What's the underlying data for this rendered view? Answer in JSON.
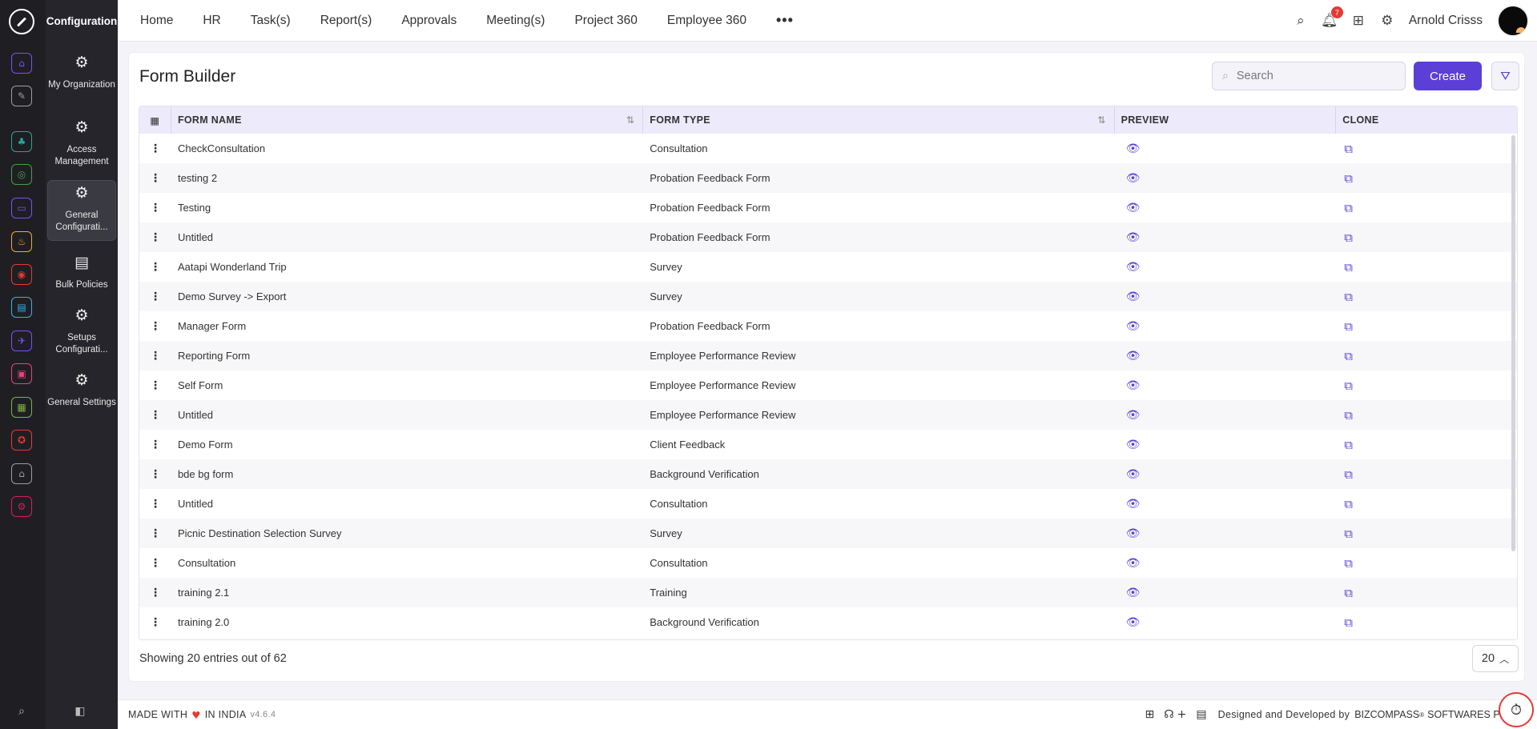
{
  "app": {
    "module_title": "Configuration"
  },
  "rail": {
    "items": [
      {
        "icon": "home-icon",
        "color": "#7c4dff",
        "glyph": "⌂"
      },
      {
        "icon": "pin-icon",
        "color": "#9e9e9e",
        "glyph": "✎"
      },
      {
        "icon": "team-icon",
        "color": "#26a69a",
        "glyph": "♣"
      },
      {
        "icon": "globe-icon",
        "color": "#43a047",
        "glyph": "◎"
      },
      {
        "icon": "briefcase-icon",
        "color": "#7c4dff",
        "glyph": "▭"
      },
      {
        "icon": "hands-icon",
        "color": "#f9a825",
        "glyph": "♨"
      },
      {
        "icon": "target-icon",
        "color": "#e53935",
        "glyph": "◉"
      },
      {
        "icon": "calendar-icon",
        "color": "#29b6f6",
        "glyph": "▤"
      },
      {
        "icon": "plane-icon",
        "color": "#7c4dff",
        "glyph": "✈"
      },
      {
        "icon": "presentation-icon",
        "color": "#ec407a",
        "glyph": "▣"
      },
      {
        "icon": "document-icon",
        "color": "#7cb342",
        "glyph": "▦"
      },
      {
        "icon": "award-icon",
        "color": "#e53935",
        "glyph": "✪"
      },
      {
        "icon": "building-icon",
        "color": "#9e9e9e",
        "glyph": "⌂"
      },
      {
        "icon": "settings-icon",
        "color": "#d81b60",
        "glyph": "⚙"
      }
    ]
  },
  "subnav": {
    "items": [
      {
        "label": "My Organization",
        "active": false
      },
      {
        "label": "Access Management",
        "active": false
      },
      {
        "label": "General Configurati...",
        "active": true
      },
      {
        "label": "Bulk Policies",
        "active": false
      },
      {
        "label": "Setups Configurati...",
        "active": false
      },
      {
        "label": "General Settings",
        "active": false
      }
    ]
  },
  "topnav": {
    "items": [
      "Home",
      "HR",
      "Task(s)",
      "Report(s)",
      "Approvals",
      "Meeting(s)",
      "Project 360",
      "Employee 360"
    ],
    "more": "•••",
    "notifications_count": "7",
    "user_name": "Arnold Crisss"
  },
  "page": {
    "title": "Form Builder",
    "search_placeholder": "Search",
    "create_label": "Create"
  },
  "table": {
    "columns": [
      "FORM NAME",
      "FORM TYPE",
      "PREVIEW",
      "CLONE"
    ],
    "rows": [
      {
        "name": "CheckConsultation",
        "type": "Consultation"
      },
      {
        "name": "testing 2",
        "type": "Probation Feedback Form"
      },
      {
        "name": "Testing",
        "type": "Probation Feedback Form"
      },
      {
        "name": "Untitled",
        "type": "Probation Feedback Form"
      },
      {
        "name": "Aatapi Wonderland Trip",
        "type": "Survey"
      },
      {
        "name": "Demo Survey -> Export",
        "type": "Survey"
      },
      {
        "name": "Manager Form",
        "type": "Probation Feedback Form"
      },
      {
        "name": "Reporting Form",
        "type": "Employee Performance Review"
      },
      {
        "name": "Self Form",
        "type": "Employee Performance Review"
      },
      {
        "name": "Untitled",
        "type": "Employee Performance Review"
      },
      {
        "name": "Demo Form",
        "type": "Client Feedback"
      },
      {
        "name": "bde bg form",
        "type": "Background Verification"
      },
      {
        "name": "Untitled",
        "type": "Consultation"
      },
      {
        "name": "Picnic Destination Selection Survey",
        "type": "Survey"
      },
      {
        "name": "Consultation",
        "type": "Consultation"
      },
      {
        "name": "training 2.1",
        "type": "Training"
      },
      {
        "name": "training 2.0",
        "type": "Background Verification"
      }
    ]
  },
  "pagination": {
    "entries_text": "Showing 20 entries out of 62",
    "page_size": "20"
  },
  "footer": {
    "made_with": "MADE WITH",
    "in_india": "IN INDIA",
    "version": "v4.6.4",
    "designed_by": "Designed and Developed by",
    "company": "BIZCOMPASS",
    "registered": "®",
    "company_suffix": "SOFTWARES PV"
  },
  "colors": {
    "accent": "#5b3fd6",
    "header_bg": "#edeafb",
    "rail_bg": "#1f1f23"
  }
}
